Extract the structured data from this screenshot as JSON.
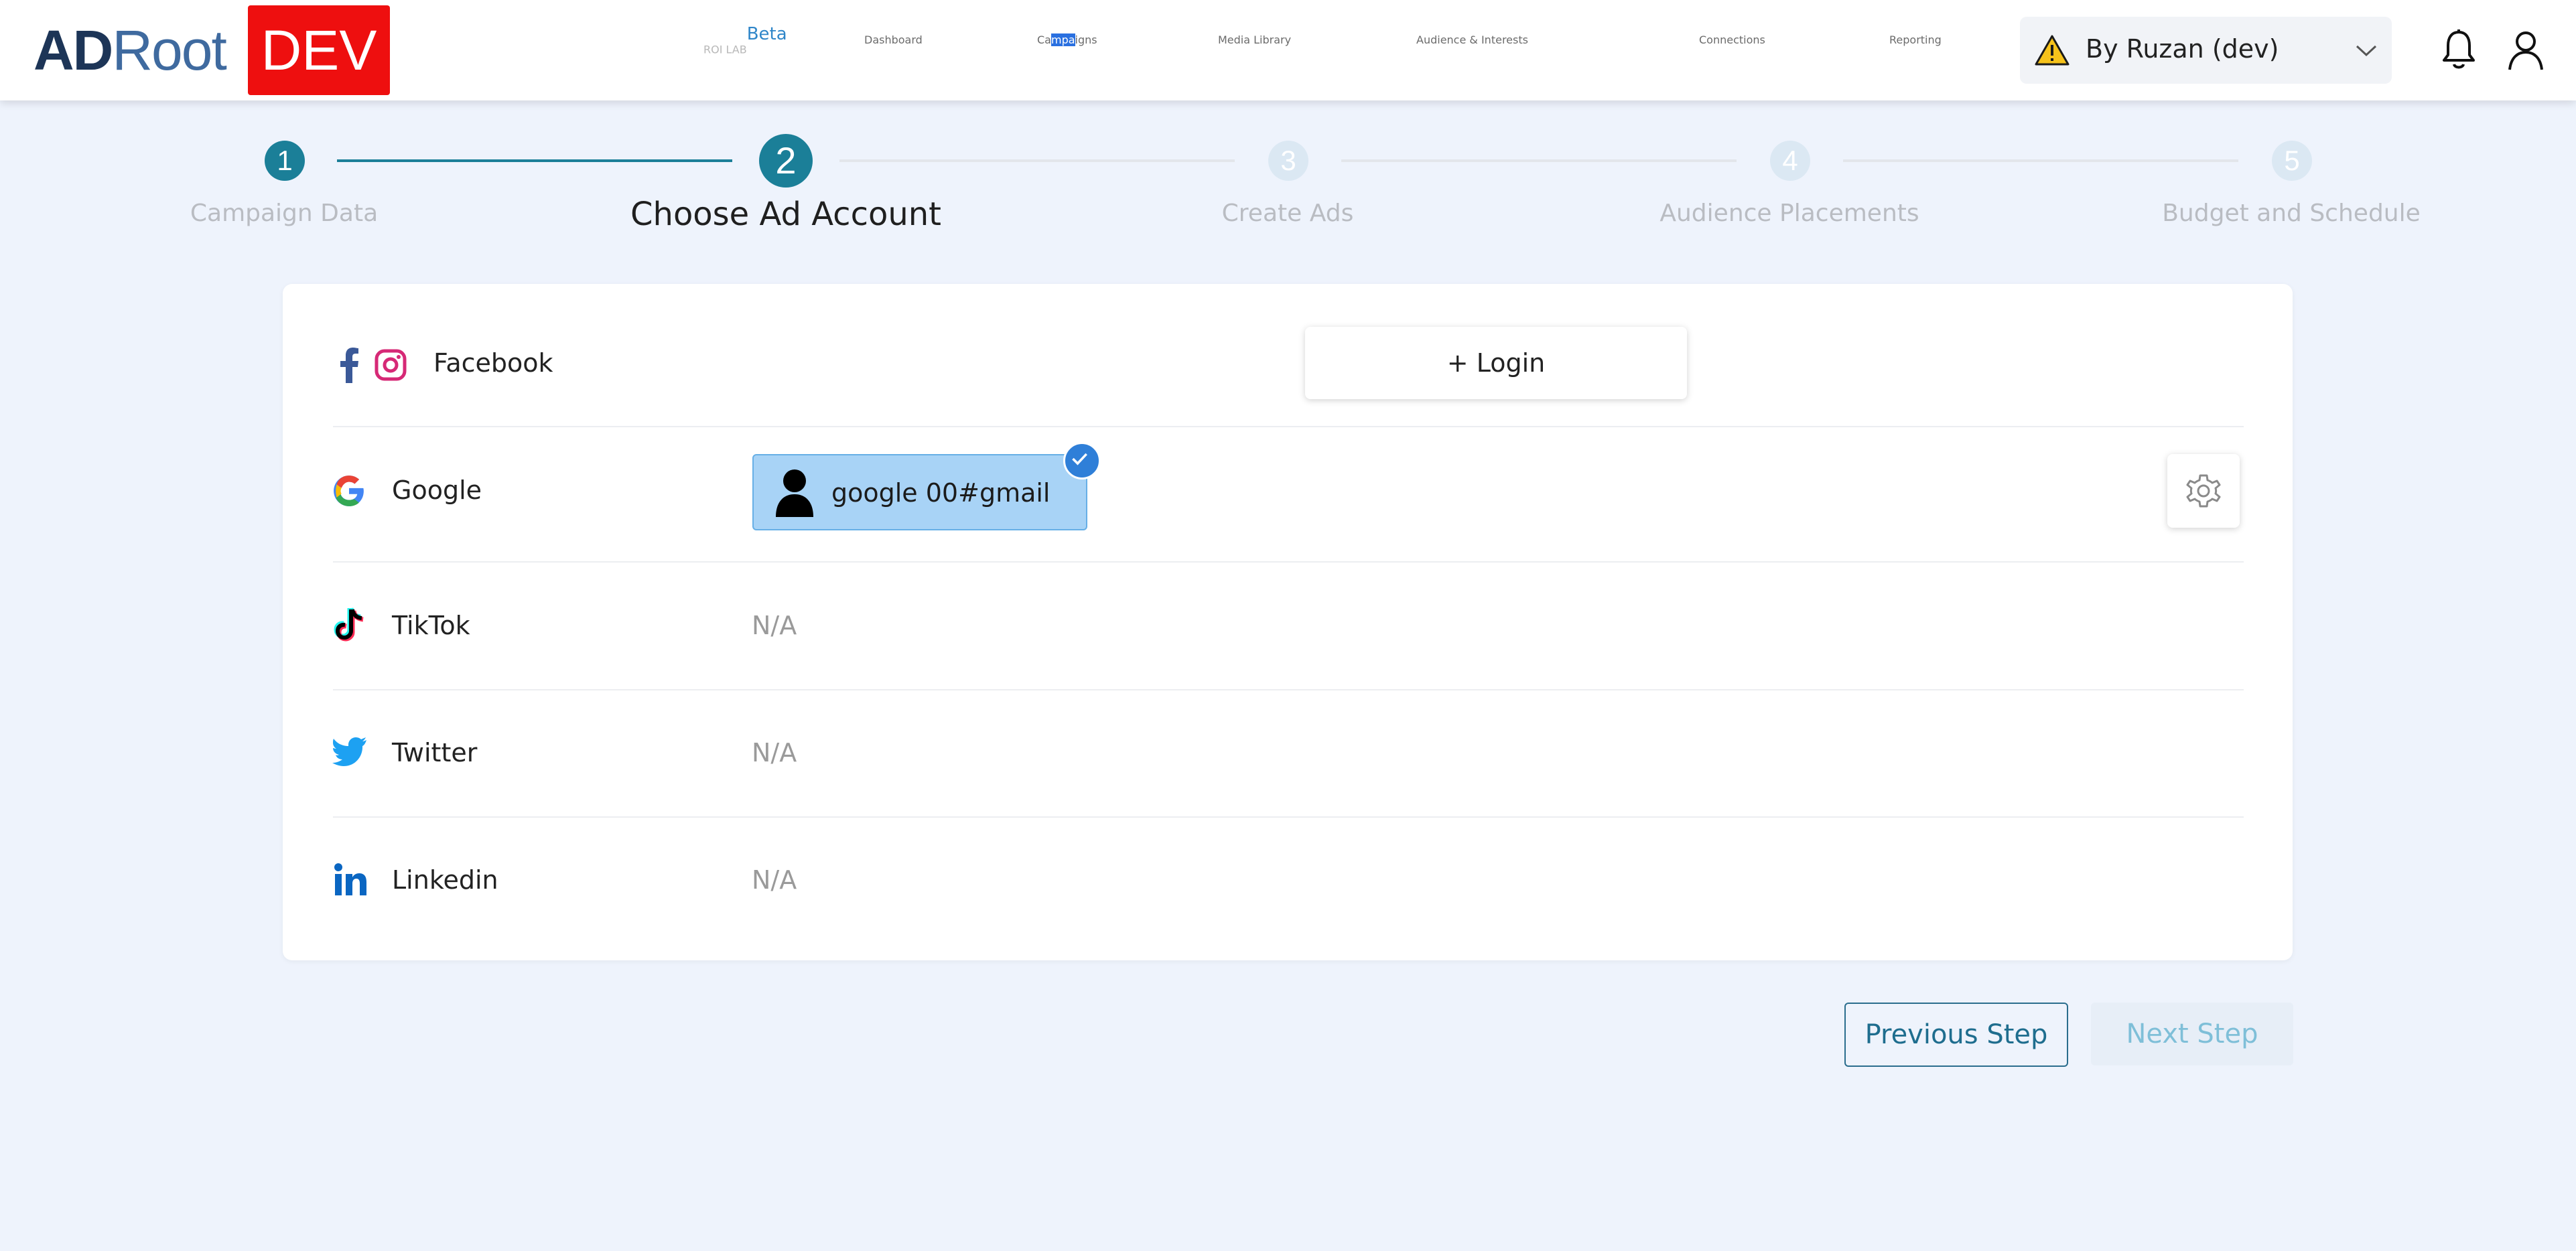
{
  "header": {
    "logo_text": "ADRoot",
    "dev_badge": "DEV",
    "nav": {
      "roi_lab": "ROI LAB",
      "roi_lab_badge": "Beta",
      "dashboard": "Dashboard",
      "campaigns_pre": "Ca",
      "campaigns_highlight": "mpa",
      "campaigns_post": "igns",
      "media_library": "Media Library",
      "audience": "Audience & Interests",
      "connections": "Connections",
      "reporting": "Reporting"
    },
    "account_selector": "By Ruzan (dev)"
  },
  "stepper": {
    "steps": [
      {
        "number": "1",
        "label": "Campaign Data",
        "state": "completed"
      },
      {
        "number": "2",
        "label": "Choose Ad Account",
        "state": "current"
      },
      {
        "number": "3",
        "label": "Create Ads",
        "state": "upcoming"
      },
      {
        "number": "4",
        "label": "Audience Placements",
        "state": "upcoming"
      },
      {
        "number": "5",
        "label": "Budget and Schedule",
        "state": "upcoming"
      }
    ]
  },
  "platforms": {
    "facebook": {
      "name": "Facebook",
      "action": "+ Login"
    },
    "google": {
      "name": "Google",
      "account": "google 00#gmail"
    },
    "tiktok": {
      "name": "TikTok",
      "value": "N/A"
    },
    "twitter": {
      "name": "Twitter",
      "value": "N/A"
    },
    "linkedin": {
      "name": "Linkedin",
      "value": "N/A"
    }
  },
  "footer": {
    "previous": "Previous Step",
    "next": "Next Step"
  },
  "colors": {
    "brand_teal": "#1e6d8e",
    "dev_red": "#ee0f0f",
    "selection_blue": "#a8d3f6",
    "page_bg": "#eef3fc"
  }
}
